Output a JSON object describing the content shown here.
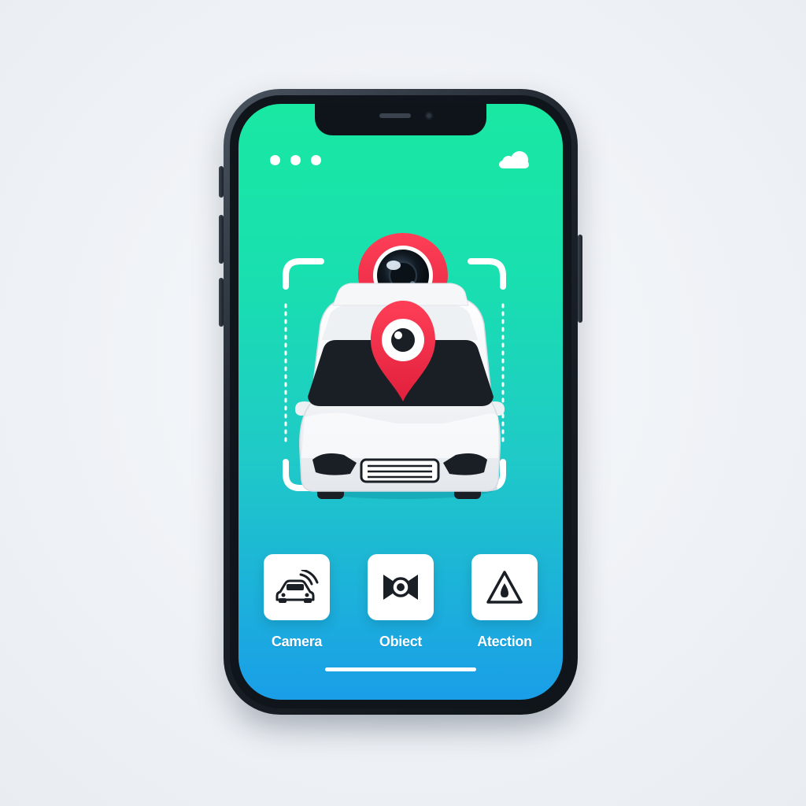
{
  "status_bar": {
    "left_icon": "three-dots-icon",
    "right_icon": "cloud-icon"
  },
  "hero": {
    "pin_icon": "location-camera-pin-icon",
    "subject_icon": "car-icon",
    "overlay_pin_icon": "eye-pin-icon",
    "frame_icon": "scan-frame-icon"
  },
  "features": [
    {
      "label": "Camera",
      "icon": "car-signal-icon"
    },
    {
      "label": "Obiect",
      "icon": "object-focus-icon"
    },
    {
      "label": "Atection",
      "icon": "warning-triangle-icon"
    }
  ],
  "colors": {
    "screen_top": "#19e8a2",
    "screen_bottom": "#1a9ee8",
    "pin_red": "#f0304a",
    "tile_bg": "#ffffff",
    "icon_dark": "#1a1f26"
  }
}
